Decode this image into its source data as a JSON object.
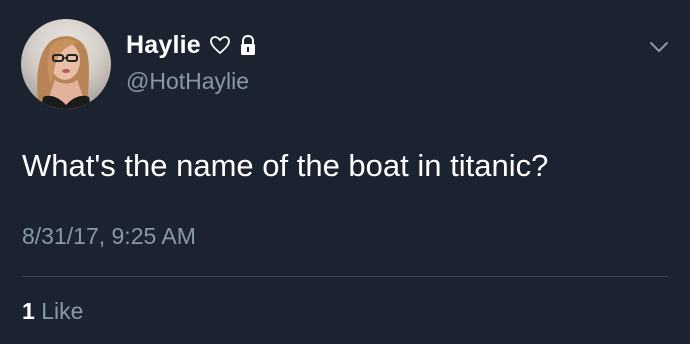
{
  "tweet": {
    "display_name": "Haylie",
    "handle": "@HotHaylie",
    "text": "What's the name of the boat in titanic?",
    "timestamp": "8/31/17, 9:25 AM",
    "like_count": "1",
    "like_label": "Like",
    "badges": [
      "heart-outline-icon",
      "lock-icon"
    ]
  },
  "colors": {
    "background": "#1b2330",
    "primary_text": "#ffffff",
    "secondary_text": "#8899a6",
    "divider": "#38444d"
  }
}
